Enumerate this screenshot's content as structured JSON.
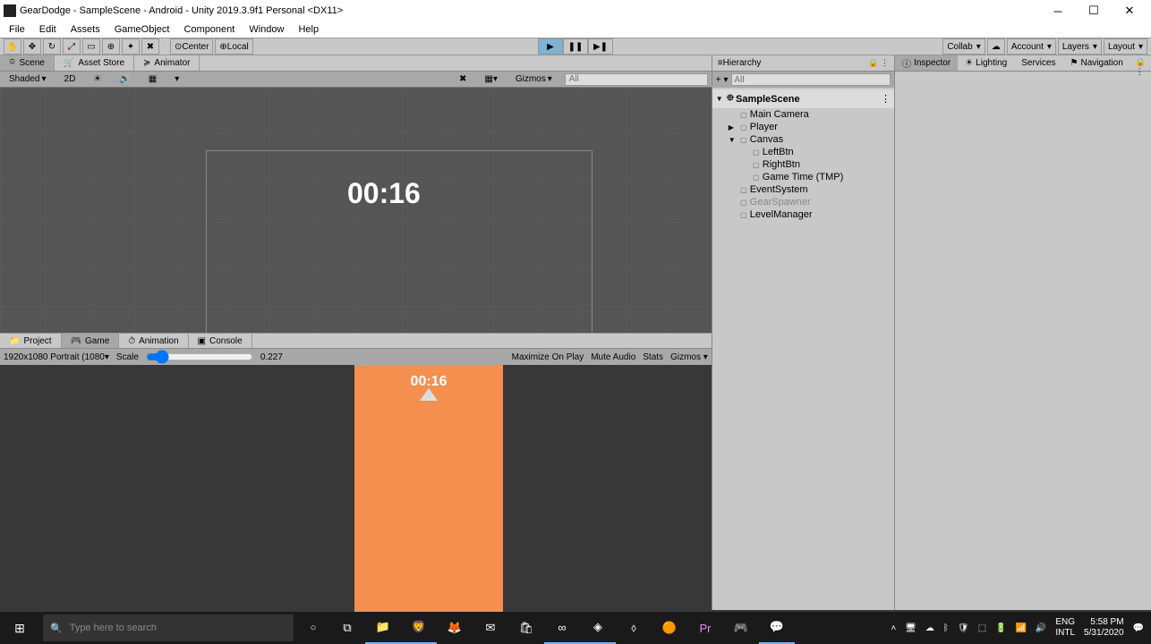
{
  "window": {
    "title": "GearDodge - SampleScene - Android - Unity 2019.3.9f1 Personal <DX11>"
  },
  "menubar": [
    "File",
    "Edit",
    "Assets",
    "GameObject",
    "Component",
    "Window",
    "Help"
  ],
  "toolbar": {
    "center_label": "Center",
    "local_label": "Local",
    "collab_label": "Collab",
    "account_label": "Account",
    "layers_label": "Layers",
    "layout_label": "Layout"
  },
  "scene_tabs": {
    "scene": "Scene",
    "asset_store": "Asset Store",
    "animator": "Animator"
  },
  "scene_toolbar": {
    "shaded": "Shaded",
    "twod": "2D",
    "gizmos": "Gizmos",
    "search_placeholder": "All"
  },
  "scene_timer": "00:16",
  "game_tabs": {
    "project": "Project",
    "game": "Game",
    "animation": "Animation",
    "console": "Console"
  },
  "game_toolbar": {
    "display": "1920x1080 Portrait (1080",
    "scale_label": "Scale",
    "scale_value": "0.227",
    "maximize": "Maximize On Play",
    "mute": "Mute Audio",
    "stats": "Stats",
    "gizmos": "Gizmos"
  },
  "game_timer": "00:16",
  "hierarchy": {
    "title": "Hierarchy",
    "search_placeholder": "All",
    "scene": "SampleScene",
    "nodes": [
      {
        "name": "Main Camera",
        "indent": 1
      },
      {
        "name": "Player",
        "indent": 1
      },
      {
        "name": "Canvas",
        "indent": 1,
        "expanded": true
      },
      {
        "name": "LeftBtn",
        "indent": 2
      },
      {
        "name": "RightBtn",
        "indent": 2
      },
      {
        "name": "Game Time (TMP)",
        "indent": 2
      },
      {
        "name": "EventSystem",
        "indent": 1
      },
      {
        "name": "GearSpawner",
        "indent": 1,
        "disabled": true
      },
      {
        "name": "LevelManager",
        "indent": 1
      }
    ]
  },
  "inspector_tabs": {
    "inspector": "Inspector",
    "lighting": "Lighting",
    "services": "Services",
    "navigation": "Navigation"
  },
  "taskbar": {
    "search_placeholder": "Type here to search",
    "lang": "ENG",
    "locale": "INTL",
    "time": "5:58 PM",
    "date": "5/31/2020"
  }
}
